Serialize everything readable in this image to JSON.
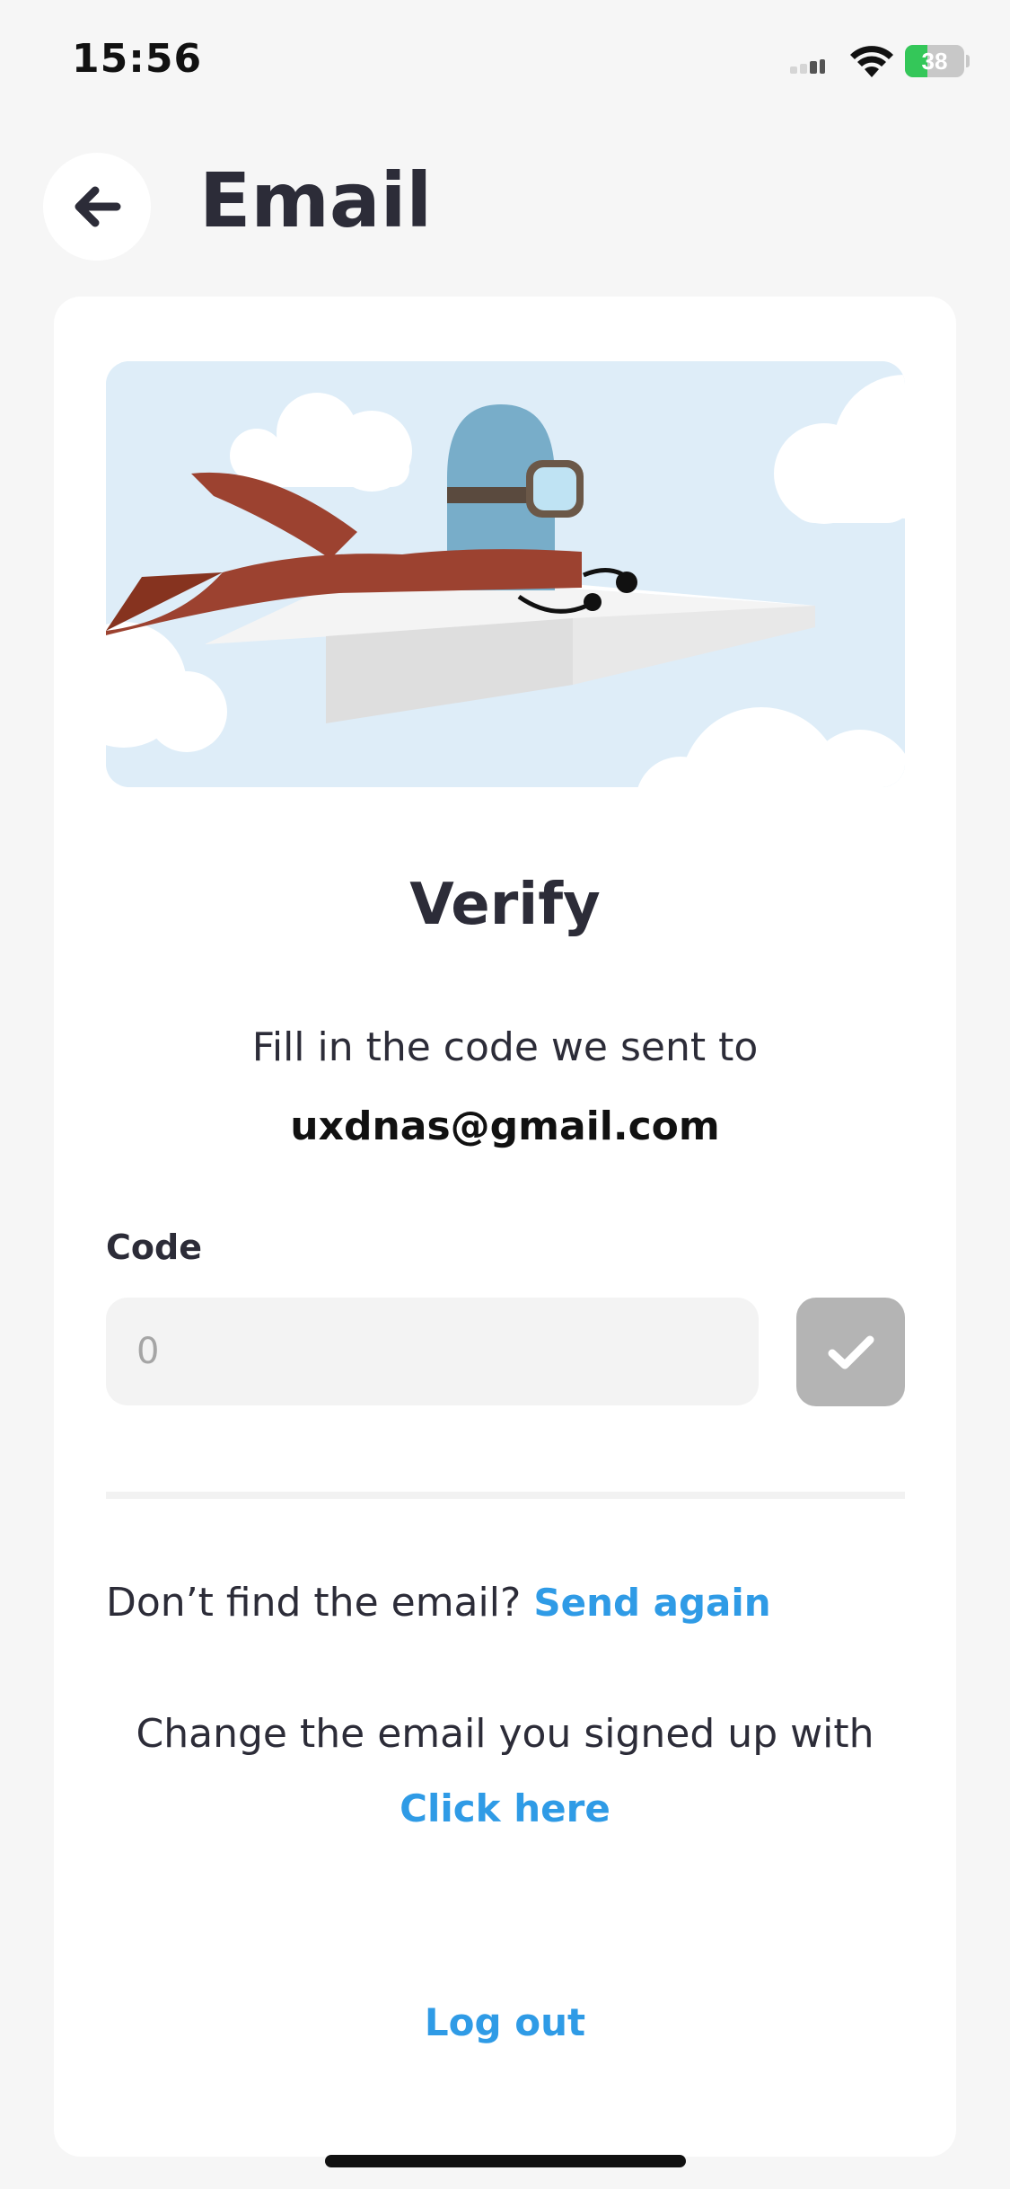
{
  "status_bar": {
    "time": "15:56",
    "battery": "38",
    "battery_level": 0.38
  },
  "header": {
    "title": "Email",
    "back_icon": "arrow-left-icon"
  },
  "verify": {
    "title": "Verify",
    "subtitle": "Fill in the code we sent to",
    "email": "uxdnas@gmail.com"
  },
  "code": {
    "label": "Code",
    "placeholder": "0",
    "value": "",
    "submit_icon": "checkmark-icon"
  },
  "resend": {
    "prompt": "Don’t find the email?",
    "link": "Send again"
  },
  "change_email": {
    "text": "Change the email you signed up with",
    "link": "Click here"
  },
  "logout": {
    "label": "Log out"
  },
  "colors": {
    "accent": "#2f9be6",
    "background": "#f6f6f6",
    "card": "#ffffff",
    "text": "#2c2c38",
    "disabled_button": "#b4b4b4",
    "battery": "#34c759"
  }
}
